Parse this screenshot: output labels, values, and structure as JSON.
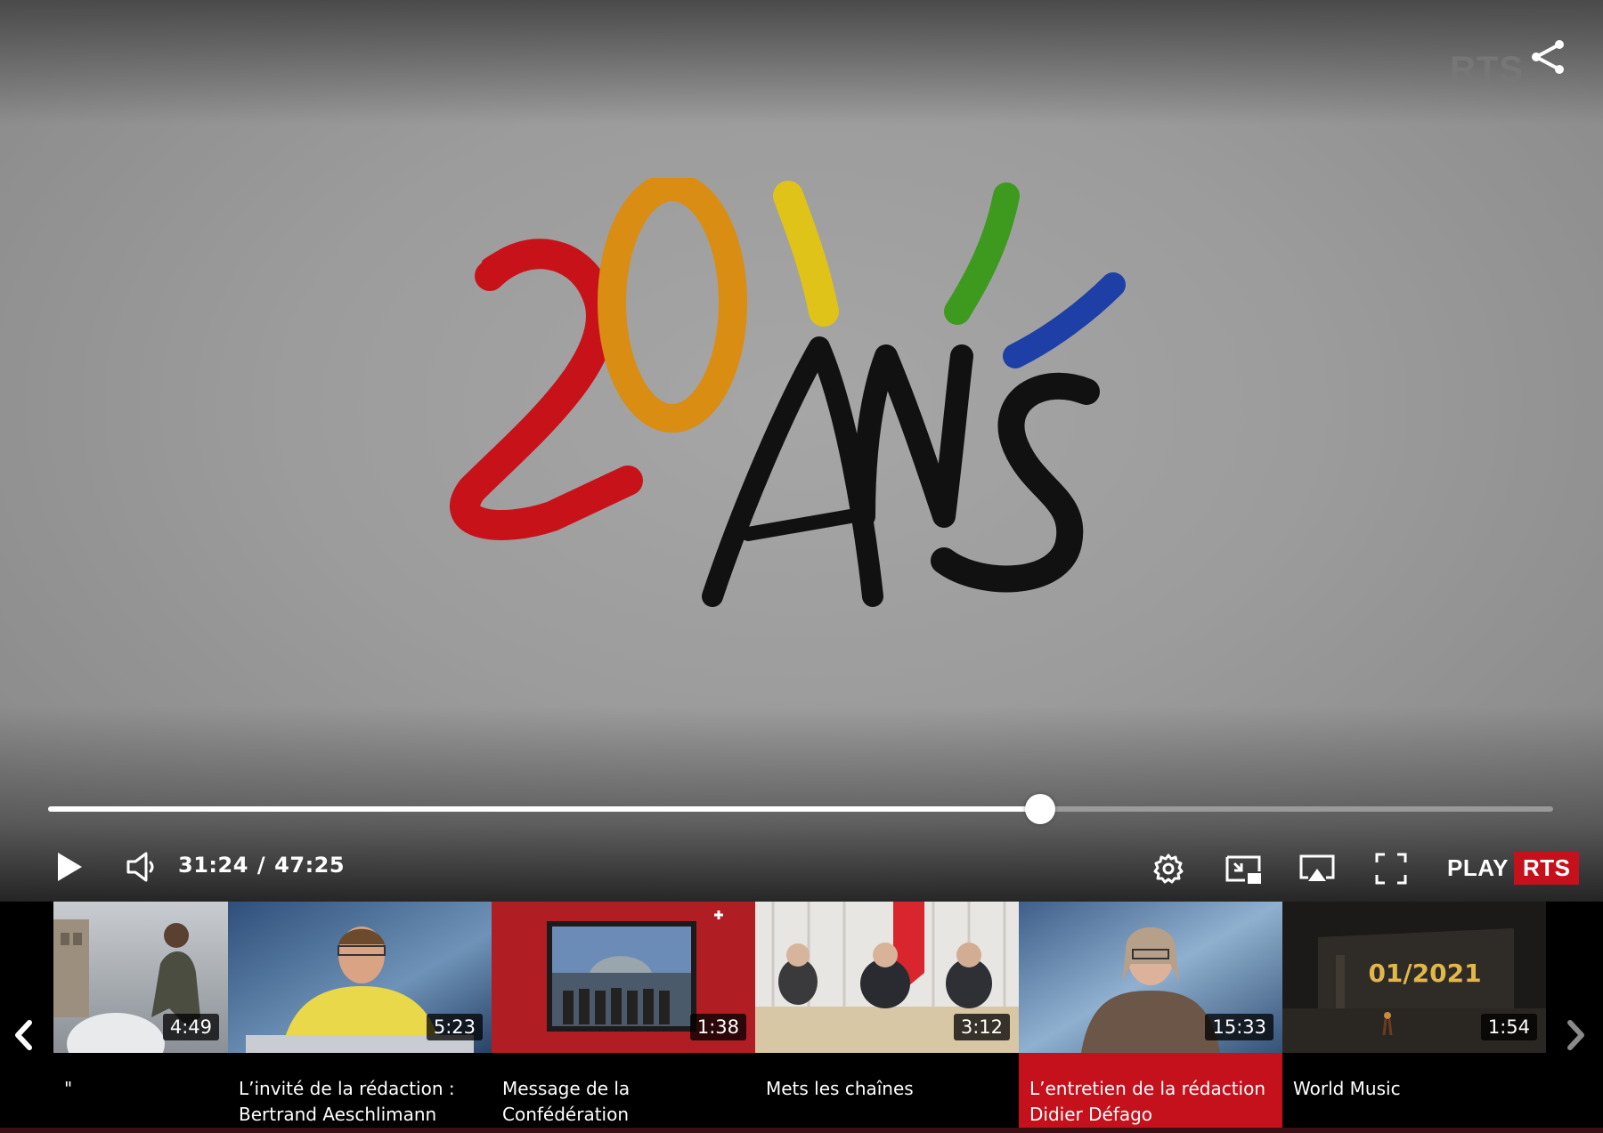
{
  "player": {
    "watermark": "RTS",
    "current_time": "31:24",
    "separator": "/",
    "total_time": "47:25",
    "progress_fraction": 0.659,
    "brand_play": "PLAY",
    "brand_rts": "RTS"
  },
  "icons": {
    "share": "share-icon",
    "play": "play-icon",
    "volume": "volume-icon",
    "settings": "gear-icon",
    "pip": "picture-in-picture-icon",
    "airplay": "airplay-icon",
    "fullscreen": "fullscreen-icon",
    "prev": "chevron-left-icon",
    "next": "chevron-right-icon"
  },
  "colors": {
    "accent": "#c4111b"
  },
  "playlist": [
    {
      "duration": "4:49",
      "title_line1": "\"",
      "title_line2": "",
      "active": false
    },
    {
      "duration": "5:23",
      "title_line1": "L’invité de la rédaction :",
      "title_line2": "Bertrand Aeschlimann",
      "active": false
    },
    {
      "duration": "1:38",
      "title_line1": "Message de la",
      "title_line2": "Confédération",
      "active": false
    },
    {
      "duration": "3:12",
      "title_line1": "Mets les chaînes",
      "title_line2": "",
      "active": false
    },
    {
      "duration": "15:33",
      "title_line1": "L’entretien de la rédaction :",
      "title_line2": "Didier Défago",
      "active": true
    },
    {
      "duration": "1:54",
      "title_line1": "World Music",
      "title_line2": "",
      "active": false,
      "thumb_text": "01/2021"
    }
  ]
}
